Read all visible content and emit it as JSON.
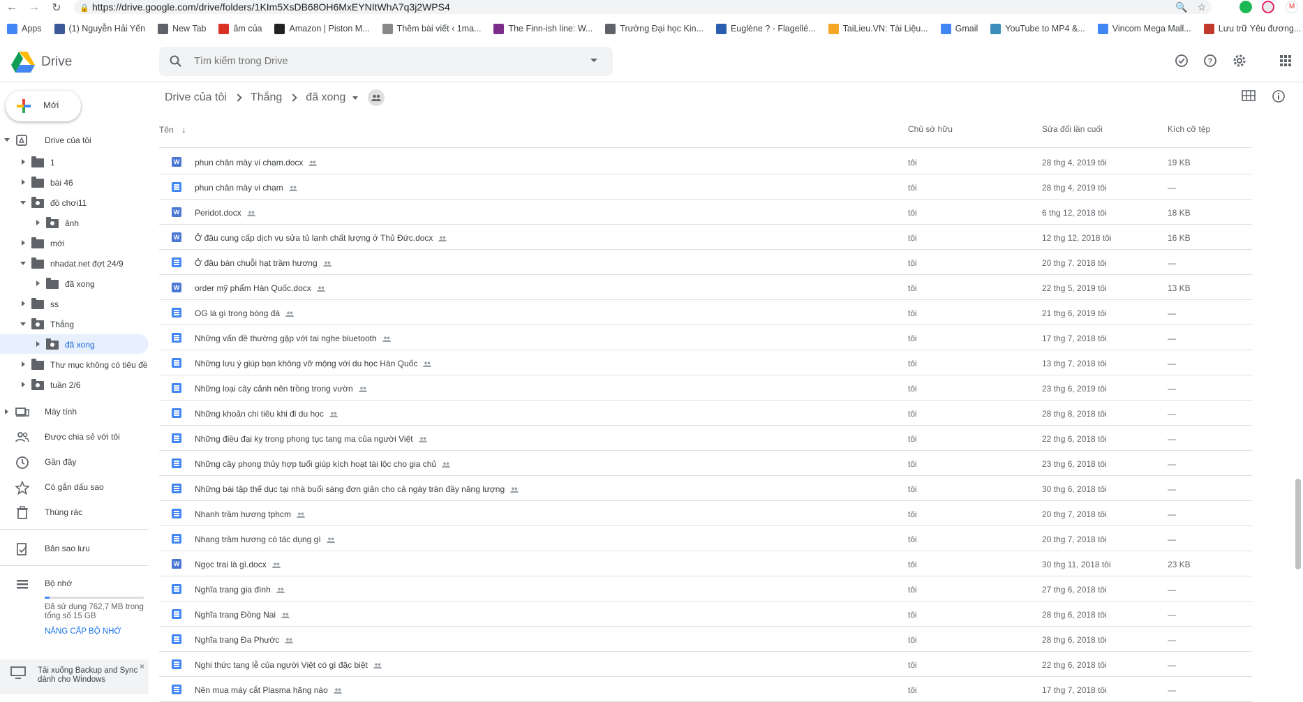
{
  "browser": {
    "url": "https://drive.google.com/drive/folders/1KIm5XsDB68OH6MxEYNItWhA7q3j2WPS4",
    "bookmarks": [
      {
        "label": "Apps",
        "icon": "apps-grid-icon",
        "color": "#4285f4"
      },
      {
        "label": "(1) Nguyễn Hải Yến",
        "icon": "facebook-icon",
        "color": "#3b5998"
      },
      {
        "label": "New Tab",
        "icon": "globe-icon",
        "color": "#5f6368"
      },
      {
        "label": "âm của",
        "icon": "gmail-icon",
        "color": "#d93025"
      },
      {
        "label": "Amazon | Piston M...",
        "icon": "amazon-icon",
        "color": "#222222"
      },
      {
        "label": "Thêm bài viết ‹ 1ma...",
        "icon": "wordpress-icon",
        "color": "#888888"
      },
      {
        "label": "The Finn-ish line: W...",
        "icon": "h-site-icon",
        "color": "#7b2d8b"
      },
      {
        "label": "Trường Đại học Kin...",
        "icon": "globe-icon",
        "color": "#5f6368"
      },
      {
        "label": "Euglène ? - Flagellé...",
        "icon": "check-site-icon",
        "color": "#2a5db0"
      },
      {
        "label": "TaiLieu.VN: Tài Liệu...",
        "icon": "tailieu-icon",
        "color": "#f5a623"
      },
      {
        "label": "Gmail",
        "icon": "google-icon",
        "color": "#4285f4"
      },
      {
        "label": "YouTube to MP4 &...",
        "icon": "convert-icon",
        "color": "#3c8dbc"
      },
      {
        "label": "Vincom Mega Mall...",
        "icon": "google-icon",
        "color": "#4285f4"
      },
      {
        "label": "Lưu trữ Yêu đương...",
        "icon": "flame-site-icon",
        "color": "#c0392b"
      }
    ]
  },
  "header": {
    "title": "Drive",
    "search_placeholder": "Tìm kiếm trong Drive"
  },
  "sidebar": {
    "new_label": "Mới",
    "my_drive": "Drive của tôi",
    "tree": [
      {
        "label": "1",
        "level": 1,
        "expanded": false,
        "shared": false
      },
      {
        "label": "bài 46",
        "level": 1,
        "expanded": false,
        "shared": false
      },
      {
        "label": "đồ chơi11",
        "level": 1,
        "expanded": true,
        "shared": true
      },
      {
        "label": "ảnh",
        "level": 2,
        "expanded": false,
        "shared": true
      },
      {
        "label": "mới",
        "level": 1,
        "expanded": false,
        "shared": false
      },
      {
        "label": "nhadat.net đợt 24/9",
        "level": 1,
        "expanded": true,
        "shared": false
      },
      {
        "label": "đã xong",
        "level": 2,
        "expanded": false,
        "shared": false
      },
      {
        "label": "ss",
        "level": 1,
        "expanded": false,
        "shared": false
      },
      {
        "label": "Thắng",
        "level": 1,
        "expanded": true,
        "shared": true
      },
      {
        "label": "đã xong",
        "level": 2,
        "expanded": false,
        "shared": true,
        "selected": true
      },
      {
        "label": "Thư mục không có tiêu đề",
        "level": 1,
        "expanded": false,
        "shared": false
      },
      {
        "label": "tuần 2/6",
        "level": 1,
        "expanded": false,
        "shared": true
      }
    ],
    "computers": "Máy tính",
    "shared_with_me": "Được chia sẻ với tôi",
    "recent": "Gần đây",
    "starred": "Có gắn dấu sao",
    "trash": "Thùng rác",
    "backups": "Bản sao lưu",
    "storage": "Bộ nhớ",
    "storage_used_line1": "Đã sử dụng 762,7 MB trong",
    "storage_used_line2": "tổng số 15 GB",
    "storage_used_fraction": 0.05,
    "upgrade": "NÂNG CẤP BỘ NHỚ",
    "backup_promo_line1": "Tải xuống Backup and Sync",
    "backup_promo_line2": "dành cho Windows"
  },
  "breadcrumb": [
    "Drive của tôi",
    "Thắng",
    "đã xong"
  ],
  "list": {
    "columns": {
      "name": "Tên",
      "owner": "Chủ sở hữu",
      "modified": "Sửa đổi lần cuối",
      "size": "Kích cỡ tệp"
    },
    "rows": [
      {
        "name": "phun chân mày vi chạm.docx",
        "type": "word",
        "owner": "tôi",
        "modified": "28 thg 4, 2019 tôi",
        "size": "19 KB"
      },
      {
        "name": "phun chân mày vi chạm",
        "type": "gdoc",
        "owner": "tôi",
        "modified": "28 thg 4, 2019 tôi",
        "size": "—"
      },
      {
        "name": "Peridot.docx",
        "type": "word",
        "owner": "tôi",
        "modified": "6 thg 12, 2018 tôi",
        "size": "18 KB"
      },
      {
        "name": "Ở đâu cung cấp dịch vụ sửa tủ lạnh chất lượng ở Thủ Đức.docx",
        "type": "word",
        "owner": "tôi",
        "modified": "12 thg 12, 2018 tôi",
        "size": "16 KB"
      },
      {
        "name": "Ở đâu bán chuỗi hạt trầm hương",
        "type": "gdoc",
        "owner": "tôi",
        "modified": "20 thg 7, 2018 tôi",
        "size": "—"
      },
      {
        "name": "order mỹ phẩm Hàn Quốc.docx",
        "type": "word",
        "owner": "tôi",
        "modified": "22 thg 5, 2019 tôi",
        "size": "13 KB"
      },
      {
        "name": "OG là gì trong bóng đá",
        "type": "gdoc",
        "owner": "tôi",
        "modified": "21 thg 6, 2019 tôi",
        "size": "—"
      },
      {
        "name": "Những vấn đề thường gặp với tai nghe bluetooth",
        "type": "gdoc",
        "owner": "tôi",
        "modified": "17 thg 7, 2018 tôi",
        "size": "—"
      },
      {
        "name": "Những lưu ý giúp bạn không vỡ mộng với du học Hàn Quốc",
        "type": "gdoc",
        "owner": "tôi",
        "modified": "13 thg 7, 2018 tôi",
        "size": "—"
      },
      {
        "name": "Những loại cây cảnh nên trồng trong vườn",
        "type": "gdoc",
        "owner": "tôi",
        "modified": "23 thg 6, 2019 tôi",
        "size": "—"
      },
      {
        "name": "Những khoản chi tiêu khi đi du học",
        "type": "gdoc",
        "owner": "tôi",
        "modified": "28 thg 8, 2018 tôi",
        "size": "—"
      },
      {
        "name": "Những điều đại kỵ trong phong tục tang ma của người Việt",
        "type": "gdoc",
        "owner": "tôi",
        "modified": "22 thg 6, 2018 tôi",
        "size": "—"
      },
      {
        "name": "Những cây phong thủy hợp tuổi giúp kích hoạt tài lộc cho gia chủ",
        "type": "gdoc",
        "owner": "tôi",
        "modified": "23 thg 6, 2018 tôi",
        "size": "—"
      },
      {
        "name": "Những bài tập thể dục tại nhà buổi sáng đơn giản cho cả ngày tràn đầy năng lượng",
        "type": "gdoc",
        "owner": "tôi",
        "modified": "30 thg 6, 2018 tôi",
        "size": "—"
      },
      {
        "name": "Nhanh trầm hương tphcm",
        "type": "gdoc",
        "owner": "tôi",
        "modified": "20 thg 7, 2018 tôi",
        "size": "—"
      },
      {
        "name": "Nhang trầm hương có tác dụng gì",
        "type": "gdoc",
        "owner": "tôi",
        "modified": "20 thg 7, 2018 tôi",
        "size": "—"
      },
      {
        "name": "Ngọc trai là gì.docx",
        "type": "word",
        "owner": "tôi",
        "modified": "30 thg 11, 2018 tôi",
        "size": "23 KB"
      },
      {
        "name": "Nghĩa trang gia đình",
        "type": "gdoc",
        "owner": "tôi",
        "modified": "27 thg 6, 2018 tôi",
        "size": "—"
      },
      {
        "name": "Nghĩa trang Đồng Nai",
        "type": "gdoc",
        "owner": "tôi",
        "modified": "28 thg 6, 2018 tôi",
        "size": "—"
      },
      {
        "name": "Nghĩa trang Đa Phước",
        "type": "gdoc",
        "owner": "tôi",
        "modified": "28 thg 6, 2018 tôi",
        "size": "—"
      },
      {
        "name": "Nghi thức tang lễ của người Việt có gì đặc biệt",
        "type": "gdoc",
        "owner": "tôi",
        "modified": "22 thg 6, 2018 tôi",
        "size": "—"
      },
      {
        "name": "Nên mua máy cắt Plasma hãng nào",
        "type": "gdoc",
        "owner": "tôi",
        "modified": "17 thg 7, 2018 tôi",
        "size": "—"
      }
    ]
  }
}
